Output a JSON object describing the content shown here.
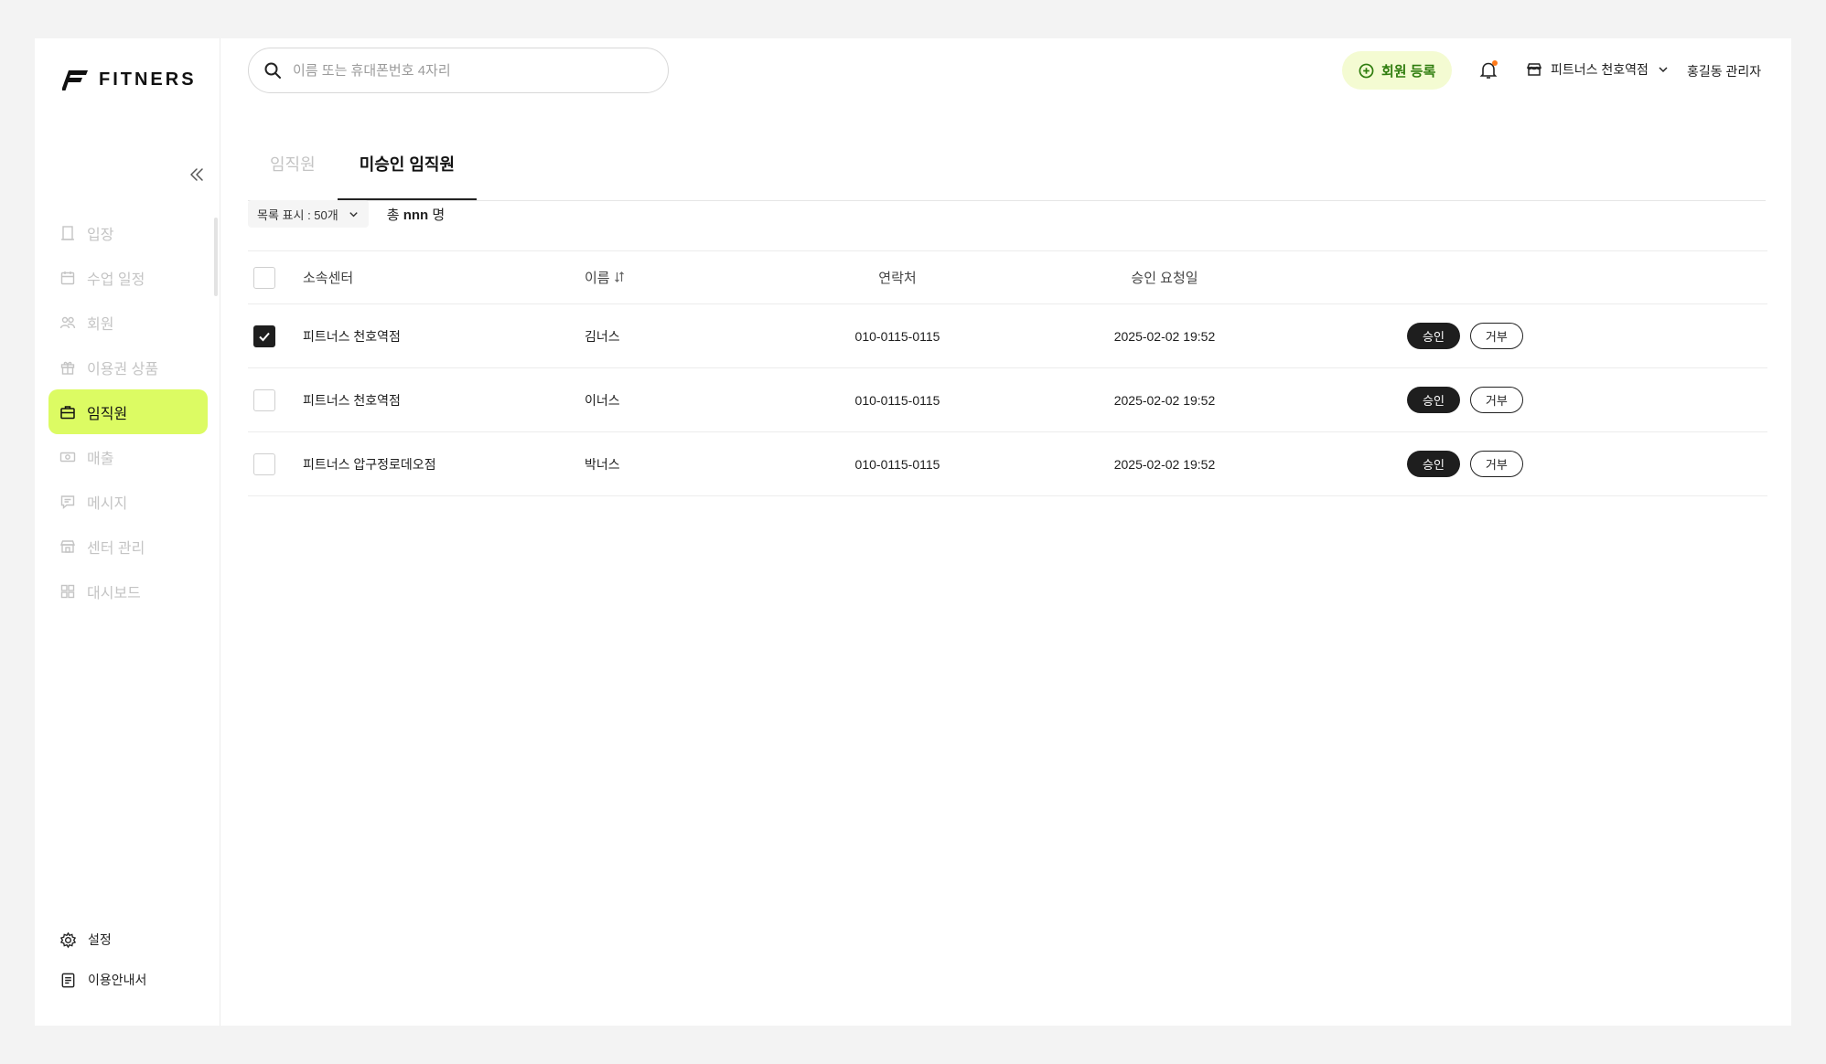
{
  "brand": {
    "name": "FITNERS"
  },
  "sidebar": {
    "items": [
      {
        "label": "입장",
        "icon": "door-icon"
      },
      {
        "label": "수업 일정",
        "icon": "calendar-icon"
      },
      {
        "label": "회원",
        "icon": "members-icon"
      },
      {
        "label": "이용권 상품",
        "icon": "gift-icon"
      },
      {
        "label": "임직원",
        "icon": "briefcase-icon",
        "active": true
      },
      {
        "label": "매출",
        "icon": "money-icon"
      },
      {
        "label": "메시지",
        "icon": "message-icon"
      },
      {
        "label": "센터 관리",
        "icon": "store-icon"
      },
      {
        "label": "대시보드",
        "icon": "dashboard-icon"
      }
    ],
    "bottom": [
      {
        "label": "설정",
        "icon": "gear-icon"
      },
      {
        "label": "이용안내서",
        "icon": "document-icon"
      }
    ]
  },
  "header": {
    "search_placeholder": "이름 또는 휴대폰번호 4자리",
    "register_label": "회원 등록",
    "center_name": "피트너스 천호역점",
    "admin_name": "홍길동 관리자"
  },
  "tabs": [
    {
      "label": "임직원",
      "active": false
    },
    {
      "label": "미승인 임직원",
      "active": true
    }
  ],
  "list": {
    "page_size_label": "목록 표시 : 50개",
    "total_prefix": "총",
    "total_value": "nnn",
    "total_suffix": "명"
  },
  "table": {
    "headers": {
      "center": "소속센터",
      "name": "이름",
      "phone": "연락처",
      "date": "승인 요청일"
    },
    "rows": [
      {
        "checked": true,
        "center": "피트너스 천호역점",
        "name": "김너스",
        "phone": "010-0115-0115",
        "date": "2025-02-02 19:52"
      },
      {
        "checked": false,
        "center": "피트너스 천호역점",
        "name": "이너스",
        "phone": "010-0115-0115",
        "date": "2025-02-02 19:52"
      },
      {
        "checked": false,
        "center": "피트너스 압구정로데오점",
        "name": "박너스",
        "phone": "010-0115-0115",
        "date": "2025-02-02 19:52"
      }
    ],
    "approve_label": "승인",
    "reject_label": "거부"
  },
  "colors": {
    "accent": "#dcfb63",
    "register_bg": "#f4fbd2",
    "register_text": "#2f7d0e",
    "notification_dot": "#ff7a1a"
  }
}
